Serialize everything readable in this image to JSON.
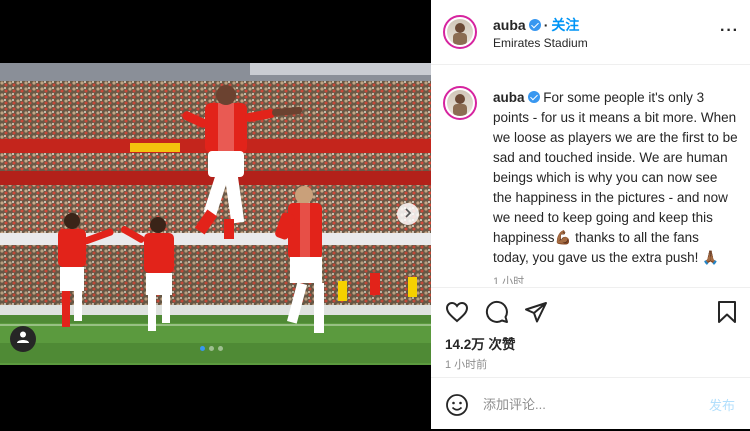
{
  "post": {
    "username": "auba",
    "follow_label": "关注",
    "separator": "·",
    "location": "Emirates Stadium",
    "more_label": "···",
    "media": {
      "slide_count": 3,
      "active_slide": 1
    }
  },
  "caption": {
    "username": "auba",
    "text": "For some people it's only 3 points - for us it means a bit more. When we loose as players we are the first to be sad and touched inside. We are human beings which is why you can now see the happiness in the pictures - and now we need to keep going and keep this happiness💪🏾 thanks to all the fans today, you gave us the extra push! 🙏🏾",
    "time": "1 小时"
  },
  "stats": {
    "likes": "14.2万 次赞",
    "time": "1 小时前"
  },
  "comment": {
    "placeholder": "添加评论...",
    "post_label": "发布"
  },
  "icons": {
    "like": "heart-icon",
    "comment": "comment-icon",
    "share": "share-icon",
    "save": "bookmark-icon",
    "emoji": "emoji-icon",
    "next": "chevron-right-icon",
    "tagged_user": "user-icon",
    "verified": "verified-badge-icon"
  },
  "colors": {
    "accent": "#0095f6",
    "post_button_disabled": "#b2dffc",
    "verified": "#3897f0",
    "arsenal_red": "#e2231a"
  }
}
